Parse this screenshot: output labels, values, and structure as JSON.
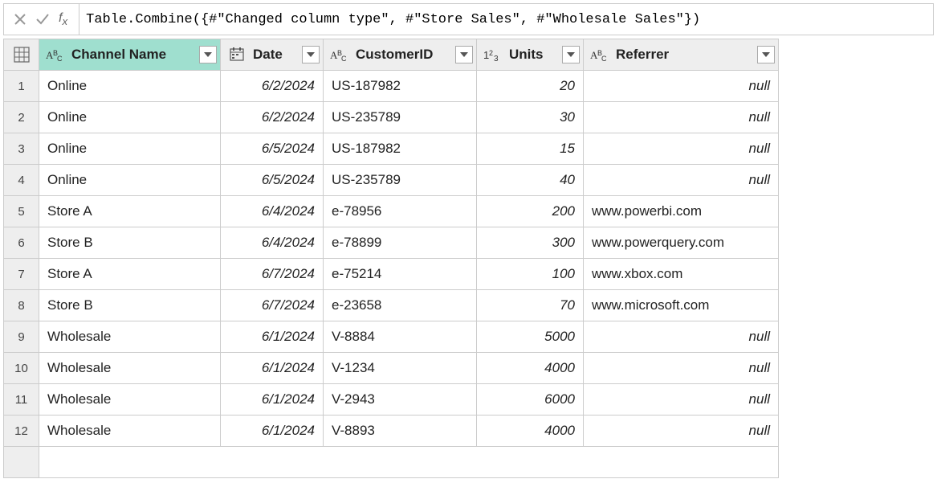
{
  "formula": "Table.Combine({#\"Changed column type\", #\"Store Sales\", #\"Wholesale Sales\"})",
  "columns": [
    {
      "name": "Channel Name",
      "type": "text",
      "selected": true
    },
    {
      "name": "Date",
      "type": "date",
      "selected": false
    },
    {
      "name": "CustomerID",
      "type": "text",
      "selected": false
    },
    {
      "name": "Units",
      "type": "number",
      "selected": false
    },
    {
      "name": "Referrer",
      "type": "text",
      "selected": false
    }
  ],
  "rows": [
    {
      "n": "1",
      "channel": "Online",
      "date": "6/2/2024",
      "cust": "US-187982",
      "units": "20",
      "ref": "null",
      "refnull": true
    },
    {
      "n": "2",
      "channel": "Online",
      "date": "6/2/2024",
      "cust": "US-235789",
      "units": "30",
      "ref": "null",
      "refnull": true
    },
    {
      "n": "3",
      "channel": "Online",
      "date": "6/5/2024",
      "cust": "US-187982",
      "units": "15",
      "ref": "null",
      "refnull": true
    },
    {
      "n": "4",
      "channel": "Online",
      "date": "6/5/2024",
      "cust": "US-235789",
      "units": "40",
      "ref": "null",
      "refnull": true
    },
    {
      "n": "5",
      "channel": "Store A",
      "date": "6/4/2024",
      "cust": "e-78956",
      "units": "200",
      "ref": "www.powerbi.com",
      "refnull": false
    },
    {
      "n": "6",
      "channel": "Store B",
      "date": "6/4/2024",
      "cust": "e-78899",
      "units": "300",
      "ref": "www.powerquery.com",
      "refnull": false
    },
    {
      "n": "7",
      "channel": "Store A",
      "date": "6/7/2024",
      "cust": "e-75214",
      "units": "100",
      "ref": "www.xbox.com",
      "refnull": false
    },
    {
      "n": "8",
      "channel": "Store B",
      "date": "6/7/2024",
      "cust": "e-23658",
      "units": "70",
      "ref": "www.microsoft.com",
      "refnull": false
    },
    {
      "n": "9",
      "channel": "Wholesale",
      "date": "6/1/2024",
      "cust": "V-8884",
      "units": "5000",
      "ref": "null",
      "refnull": true
    },
    {
      "n": "10",
      "channel": "Wholesale",
      "date": "6/1/2024",
      "cust": "V-1234",
      "units": "4000",
      "ref": "null",
      "refnull": true
    },
    {
      "n": "11",
      "channel": "Wholesale",
      "date": "6/1/2024",
      "cust": "V-2943",
      "units": "6000",
      "ref": "null",
      "refnull": true
    },
    {
      "n": "12",
      "channel": "Wholesale",
      "date": "6/1/2024",
      "cust": "V-8893",
      "units": "4000",
      "ref": "null",
      "refnull": true
    }
  ]
}
